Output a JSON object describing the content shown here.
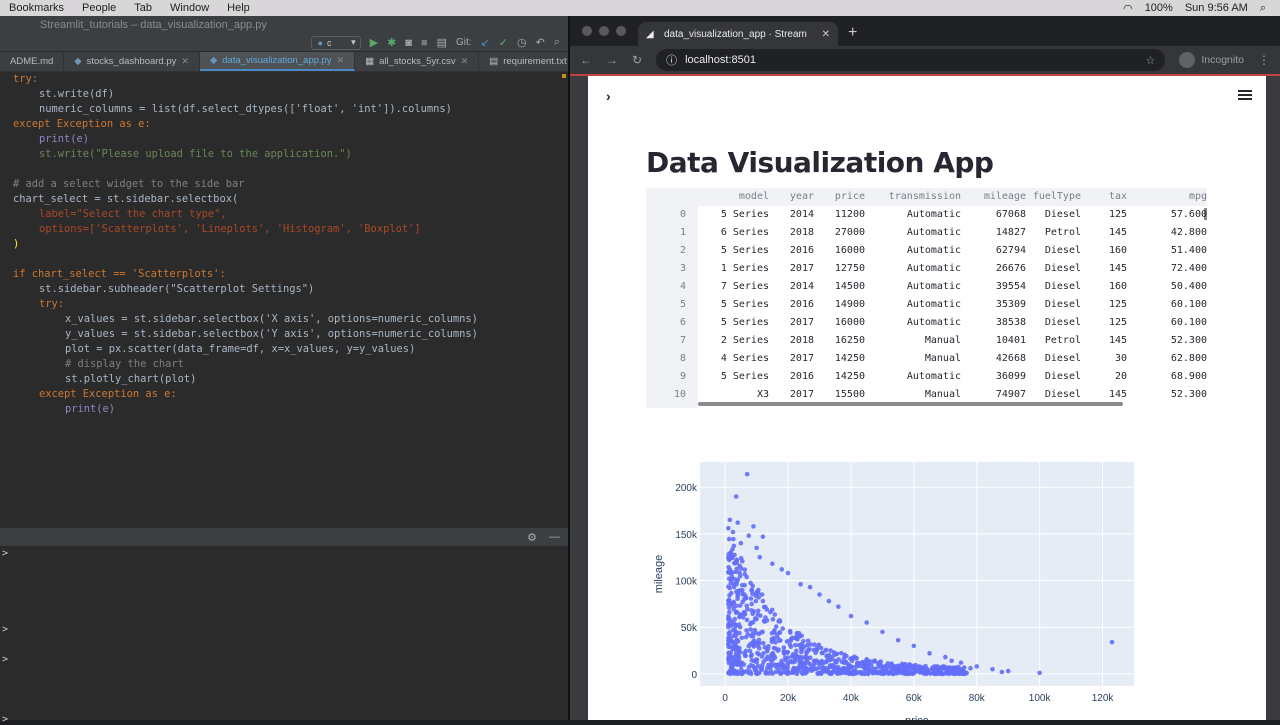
{
  "menubar": {
    "items": [
      "Bookmarks",
      "People",
      "Tab",
      "Window",
      "Help"
    ],
    "battery": "100%",
    "clock": "Sun 9:56 AM"
  },
  "ide": {
    "window_title": "Streamlit_tutorials – data_visualization_app.py",
    "run_config": "c",
    "git_label": "Git:",
    "tabs": [
      {
        "label": "ADME.md",
        "active": false
      },
      {
        "label": "stocks_dashboard.py",
        "active": false
      },
      {
        "label": "data_visualization_app.py",
        "active": true
      },
      {
        "label": "all_stocks_5yr.csv",
        "active": false
      },
      {
        "label": "requirement.txt",
        "active": false
      }
    ],
    "code_lines": [
      {
        "n": 1,
        "indent": 0,
        "text": "try:"
      },
      {
        "n": 2,
        "indent": 1,
        "text": "st.write(df)"
      },
      {
        "n": 3,
        "indent": 1,
        "text": "numeric_columns = list(df.select_dtypes(['float', 'int']).columns)"
      },
      {
        "n": 4,
        "indent": 0,
        "text": "except Exception as e:"
      },
      {
        "n": 5,
        "indent": 1,
        "text": "print(e)"
      },
      {
        "n": 6,
        "indent": 1,
        "text": "st.write(\"Please upload file to the application.\")"
      },
      {
        "n": 7,
        "indent": 0,
        "text": ""
      },
      {
        "n": 8,
        "indent": 0,
        "text": "# add a select widget to the side bar"
      },
      {
        "n": 9,
        "indent": 0,
        "text": "chart_select = st.sidebar.selectbox("
      },
      {
        "n": 10,
        "indent": 1,
        "text": "label=\"Select the chart type\","
      },
      {
        "n": 11,
        "indent": 1,
        "text": "options=['Scatterplots', 'Lineplots', 'Histogram', 'Boxplot']"
      },
      {
        "n": 12,
        "indent": 0,
        "text": ")"
      },
      {
        "n": 13,
        "indent": 0,
        "text": ""
      },
      {
        "n": 14,
        "indent": 0,
        "text": ""
      },
      {
        "n": 15,
        "indent": 0,
        "text": "if chart_select == 'Scatterplots':"
      },
      {
        "n": 16,
        "indent": 1,
        "text": "st.sidebar.subheader(\"Scatterplot Settings\")"
      },
      {
        "n": 17,
        "indent": 1,
        "text": "try:"
      },
      {
        "n": 18,
        "indent": 2,
        "text": "x_values = st.sidebar.selectbox('X axis', options=numeric_columns)"
      },
      {
        "n": 19,
        "indent": 2,
        "text": "y_values = st.sidebar.selectbox('Y axis', options=numeric_columns)"
      },
      {
        "n": 20,
        "indent": 2,
        "text": "plot = px.scatter(data_frame=df, x=x_values, y=y_values)"
      },
      {
        "n": 21,
        "indent": 2,
        "text": "# display the chart"
      },
      {
        "n": 22,
        "indent": 2,
        "text": "st.plotly_chart(plot)"
      },
      {
        "n": 23,
        "indent": 1,
        "text": "except Exception as e:"
      },
      {
        "n": 24,
        "indent": 2,
        "text": "print(e)"
      }
    ],
    "console_prompts": [
      ">",
      ">",
      ">",
      ">"
    ]
  },
  "browser": {
    "tab_title": "data_visualization_app · Stream",
    "url": "localhost:8501",
    "profile": "Incognito"
  },
  "app": {
    "title": "Data Visualization App",
    "table": {
      "columns": [
        "",
        "model",
        "year",
        "price",
        "transmission",
        "mileage",
        "fuelType",
        "tax",
        "mpg"
      ],
      "rows": [
        [
          "0",
          "5 Series",
          "2014",
          "11200",
          "Automatic",
          "67068",
          "Diesel",
          "125",
          "57.600"
        ],
        [
          "1",
          "6 Series",
          "2018",
          "27000",
          "Automatic",
          "14827",
          "Petrol",
          "145",
          "42.800"
        ],
        [
          "2",
          "5 Series",
          "2016",
          "16000",
          "Automatic",
          "62794",
          "Diesel",
          "160",
          "51.400"
        ],
        [
          "3",
          "1 Series",
          "2017",
          "12750",
          "Automatic",
          "26676",
          "Diesel",
          "145",
          "72.400"
        ],
        [
          "4",
          "7 Series",
          "2014",
          "14500",
          "Automatic",
          "39554",
          "Diesel",
          "160",
          "50.400"
        ],
        [
          "5",
          "5 Series",
          "2016",
          "14900",
          "Automatic",
          "35309",
          "Diesel",
          "125",
          "60.100"
        ],
        [
          "6",
          "5 Series",
          "2017",
          "16000",
          "Automatic",
          "38538",
          "Diesel",
          "125",
          "60.100"
        ],
        [
          "7",
          "2 Series",
          "2018",
          "16250",
          "Manual",
          "10401",
          "Petrol",
          "145",
          "52.300"
        ],
        [
          "8",
          "4 Series",
          "2017",
          "14250",
          "Manual",
          "42668",
          "Diesel",
          "30",
          "62.800"
        ],
        [
          "9",
          "5 Series",
          "2016",
          "14250",
          "Automatic",
          "36099",
          "Diesel",
          "20",
          "68.900"
        ],
        [
          "10",
          "X3",
          "2017",
          "15500",
          "Manual",
          "74907",
          "Diesel",
          "145",
          "52.300"
        ]
      ]
    }
  },
  "chart_data": {
    "type": "scatter",
    "xlabel": "price",
    "ylabel": "mileage",
    "xlim": [
      -8000,
      130000
    ],
    "ylim": [
      -13000,
      227000
    ],
    "xticks": [
      0,
      20000,
      40000,
      60000,
      80000,
      100000,
      120000
    ],
    "xtick_labels": [
      "0",
      "20k",
      "40k",
      "60k",
      "80k",
      "100k",
      "120k"
    ],
    "yticks": [
      0,
      50000,
      100000,
      150000,
      200000
    ],
    "ytick_labels": [
      "0",
      "50k",
      "100k",
      "150k",
      "200k"
    ],
    "marker_color": "#636efa",
    "grid": true,
    "points": [
      [
        7000,
        214000
      ],
      [
        3500,
        190000
      ],
      [
        1500,
        165000
      ],
      [
        4000,
        162000
      ],
      [
        2500,
        152000
      ],
      [
        9000,
        158000
      ],
      [
        7500,
        148000
      ],
      [
        12000,
        147000
      ],
      [
        5000,
        140000
      ],
      [
        10000,
        135000
      ],
      [
        11000,
        125000
      ],
      [
        15000,
        118000
      ],
      [
        18000,
        112000
      ],
      [
        20000,
        108000
      ],
      [
        24000,
        96000
      ],
      [
        27000,
        93000
      ],
      [
        30000,
        85000
      ],
      [
        33000,
        78000
      ],
      [
        36000,
        72000
      ],
      [
        40000,
        62000
      ],
      [
        45000,
        55000
      ],
      [
        50000,
        45000
      ],
      [
        55000,
        36000
      ],
      [
        60000,
        30000
      ],
      [
        65000,
        22000
      ],
      [
        70000,
        18000
      ],
      [
        75000,
        12000
      ],
      [
        80000,
        8000
      ],
      [
        85000,
        5000
      ],
      [
        90000,
        3000
      ],
      [
        100000,
        1000
      ],
      [
        123000,
        34000
      ],
      [
        78000,
        6000
      ],
      [
        88000,
        2000
      ],
      [
        72000,
        14000
      ]
    ]
  }
}
